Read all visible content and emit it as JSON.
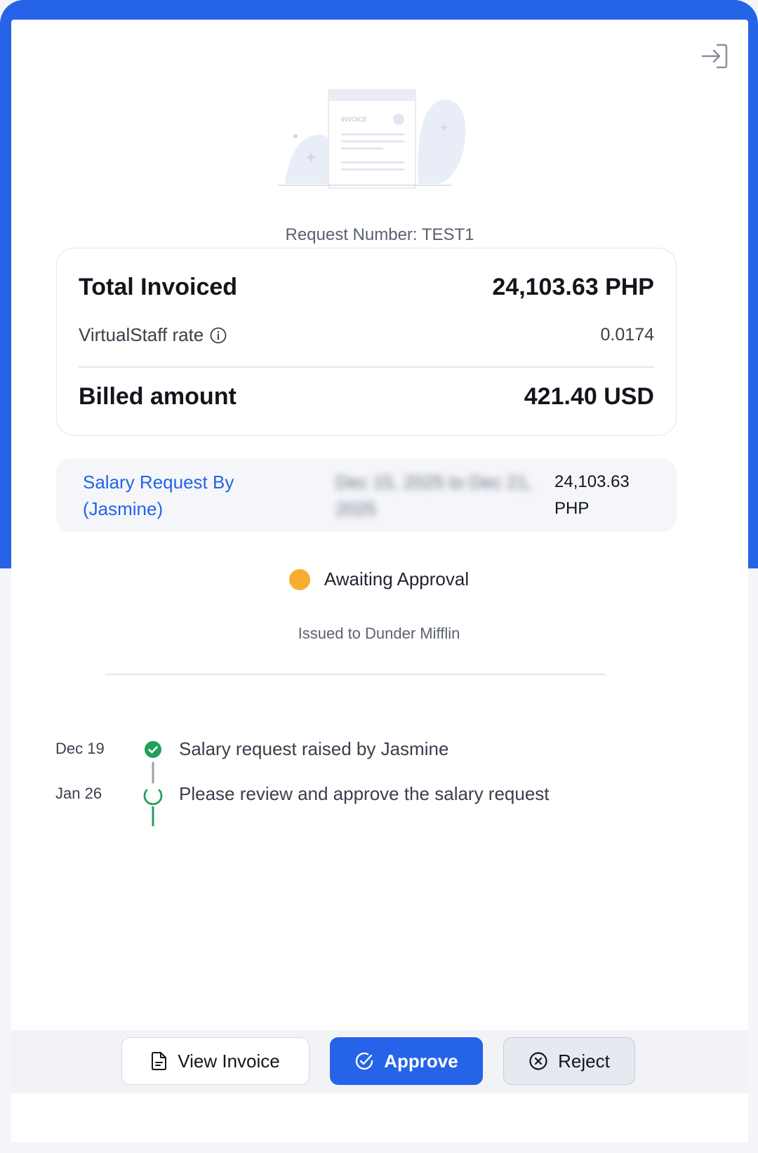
{
  "request": {
    "number_label": "Request Number: TEST1"
  },
  "summary": {
    "total_label": "Total Invoiced",
    "total_value": "24,103.63 PHP",
    "rate_label": "VirtualStaff rate",
    "rate_value": "0.0174",
    "billed_label": "Billed amount",
    "billed_value": "421.40 USD"
  },
  "salary": {
    "link_text": "Salary Request By (Jasmine)",
    "period": "Dec 15, 2025 to Dec 21, 2025",
    "amount": "24,103.63 PHP"
  },
  "status": {
    "text": "Awaiting Approval",
    "color": "#f7ae2e"
  },
  "issued": {
    "text": "Issued to Dunder Mifflin"
  },
  "timeline": [
    {
      "date": "Dec 19",
      "text": "Salary request raised by Jasmine",
      "state": "done"
    },
    {
      "date": "Jan 26",
      "text": "Please review and approve the salary request",
      "state": "pending"
    }
  ],
  "illustration": {
    "label": "INVOICE"
  },
  "actions": {
    "view_invoice": "View Invoice",
    "approve": "Approve",
    "reject": "Reject"
  },
  "colors": {
    "accent": "#2563e8",
    "success": "#22a05a",
    "warning": "#f7ae2e"
  },
  "icons": [
    "exit-icon",
    "info-icon",
    "check-circle-icon",
    "loading-circle-icon",
    "document-icon",
    "approve-check-icon",
    "reject-x-icon"
  ]
}
